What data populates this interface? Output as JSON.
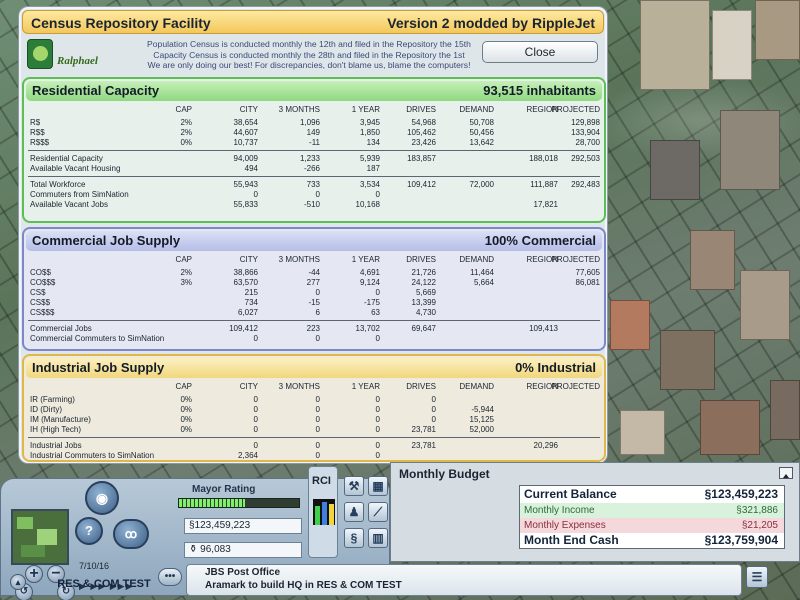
{
  "window": {
    "title": "Census Repository Facility",
    "version": "Version 2 modded by RippleJet",
    "logo_text": "Ralphael",
    "notice_lines": [
      "Population Census is conducted monthly the 12th and filed in the Repository the 15th",
      "Capacity Census is conducted monthly the 28th and filed in the Repository the 1st",
      "We are only doing our best! For discrepancies, don't blame us, blame the computers!"
    ],
    "close_label": "Close"
  },
  "columns": {
    "cap": "CAP",
    "city": "CITY",
    "m3": "3 MONTHS",
    "y1": "1 YEAR",
    "drives": "DRIVES",
    "demand": "DEMAND",
    "region": "REGION",
    "projected": "PROJECTED"
  },
  "residential": {
    "title": "Residential Capacity",
    "summary": "93,515 inhabitants",
    "rows": [
      {
        "label": "R$",
        "cap": "2%",
        "city": "38,654",
        "m3": "1,096",
        "y1": "3,945",
        "drives": "54,968",
        "demand": "50,708",
        "region": "",
        "projected": "129,898"
      },
      {
        "label": "R$$",
        "cap": "2%",
        "city": "44,607",
        "m3": "149",
        "y1": "1,850",
        "drives": "105,462",
        "demand": "50,456",
        "region": "",
        "projected": "133,904"
      },
      {
        "label": "R$$$",
        "cap": "0%",
        "city": "10,737",
        "m3": "-11",
        "y1": "134",
        "drives": "23,426",
        "demand": "13,642",
        "region": "",
        "projected": "28,700"
      },
      {
        "label": "Residential Capacity",
        "cap": "",
        "city": "94,009",
        "m3": "1,233",
        "y1": "5,939",
        "drives": "183,857",
        "demand": "",
        "region": "188,018",
        "projected": "292,503"
      },
      {
        "label": "Available Vacant Housing",
        "cap": "",
        "city": "494",
        "m3": "-266",
        "y1": "187",
        "drives": "",
        "demand": "",
        "region": "",
        "projected": ""
      },
      {
        "label": "Total Workforce",
        "cap": "",
        "city": "55,943",
        "m3": "733",
        "y1": "3,534",
        "drives": "109,412",
        "demand": "72,000",
        "region": "111,887",
        "projected": "292,483"
      },
      {
        "label": "Commuters from SimNation",
        "cap": "",
        "city": "0",
        "m3": "0",
        "y1": "0",
        "drives": "",
        "demand": "",
        "region": "",
        "projected": ""
      },
      {
        "label": "Available Vacant Jobs",
        "cap": "",
        "city": "55,833",
        "m3": "-510",
        "y1": "10,168",
        "drives": "",
        "demand": "",
        "region": "17,821",
        "projected": ""
      }
    ]
  },
  "commercial": {
    "title": "Commercial Job Supply",
    "summary": "100% Commercial",
    "rows": [
      {
        "label": "CO$$",
        "cap": "2%",
        "city": "38,866",
        "m3": "-44",
        "y1": "4,691",
        "drives": "21,726",
        "demand": "11,464",
        "region": "",
        "projected": "77,605"
      },
      {
        "label": "CO$$$",
        "cap": "3%",
        "city": "63,570",
        "m3": "277",
        "y1": "9,124",
        "drives": "24,122",
        "demand": "5,664",
        "region": "",
        "projected": "86,081"
      },
      {
        "label": "CS$",
        "cap": "",
        "city": "215",
        "m3": "0",
        "y1": "0",
        "drives": "5,669",
        "demand": "",
        "region": "",
        "projected": ""
      },
      {
        "label": "CS$$",
        "cap": "",
        "city": "734",
        "m3": "-15",
        "y1": "-175",
        "drives": "13,399",
        "demand": "",
        "region": "",
        "projected": ""
      },
      {
        "label": "CS$$$",
        "cap": "",
        "city": "6,027",
        "m3": "6",
        "y1": "63",
        "drives": "4,730",
        "demand": "",
        "region": "",
        "projected": ""
      },
      {
        "label": "Commercial Jobs",
        "cap": "",
        "city": "109,412",
        "m3": "223",
        "y1": "13,702",
        "drives": "69,647",
        "demand": "",
        "region": "109,413",
        "projected": ""
      },
      {
        "label": "Commercial Commuters to SimNation",
        "cap": "",
        "city": "0",
        "m3": "0",
        "y1": "0",
        "drives": "",
        "demand": "",
        "region": "",
        "projected": ""
      }
    ]
  },
  "industrial": {
    "title": "Industrial Job Supply",
    "summary": "0% Industrial",
    "rows": [
      {
        "label": "IR (Farming)",
        "cap": "0%",
        "city": "0",
        "m3": "0",
        "y1": "0",
        "drives": "0",
        "demand": "",
        "region": "",
        "projected": ""
      },
      {
        "label": "ID (Dirty)",
        "cap": "0%",
        "city": "0",
        "m3": "0",
        "y1": "0",
        "drives": "0",
        "demand": "-5,944",
        "region": "",
        "projected": ""
      },
      {
        "label": "IM (Manufacture)",
        "cap": "0%",
        "city": "0",
        "m3": "0",
        "y1": "0",
        "drives": "0",
        "demand": "15,125",
        "region": "",
        "projected": ""
      },
      {
        "label": "IH (High Tech)",
        "cap": "0%",
        "city": "0",
        "m3": "0",
        "y1": "0",
        "drives": "23,781",
        "demand": "52,000",
        "region": "",
        "projected": ""
      },
      {
        "label": "Industrial Jobs",
        "cap": "",
        "city": "0",
        "m3": "0",
        "y1": "0",
        "drives": "23,781",
        "demand": "",
        "region": "20,296",
        "projected": ""
      },
      {
        "label": "Industrial Commuters to SimNation",
        "cap": "",
        "city": "2,364",
        "m3": "0",
        "y1": "0",
        "drives": "",
        "demand": "",
        "region": "",
        "projected": ""
      }
    ]
  },
  "controls": {
    "date": "7/10/16",
    "city_name": "RES & COM TEST",
    "speed_icons": "▶ ▶▶ ▶▶▶"
  },
  "mayor": {
    "label": "Mayor Rating",
    "rating_level": 0.55,
    "funds": "§123,459,223",
    "population": "96,083"
  },
  "rci": {
    "label": "RCI",
    "r_level": 0.75,
    "c_level": 0.9,
    "i_level": 0.8,
    "colors": {
      "r": "#3fd14a",
      "c": "#3f7fe0",
      "i": "#f2d43b"
    }
  },
  "budget": {
    "title": "Monthly Budget",
    "current_balance_label": "Current Balance",
    "current_balance": "§123,459,223",
    "income_label": "Monthly Income",
    "income": "§321,886",
    "expenses_label": "Monthly Expenses",
    "expenses": "§21,205",
    "month_end_label": "Month End Cash",
    "month_end": "§123,759,904",
    "income_color": "#d9f2dd",
    "expenses_color": "#f4d8dc"
  },
  "news": {
    "line1": "JBS Post Office",
    "line2": "Aramark to build HQ in RES & COM TEST"
  }
}
